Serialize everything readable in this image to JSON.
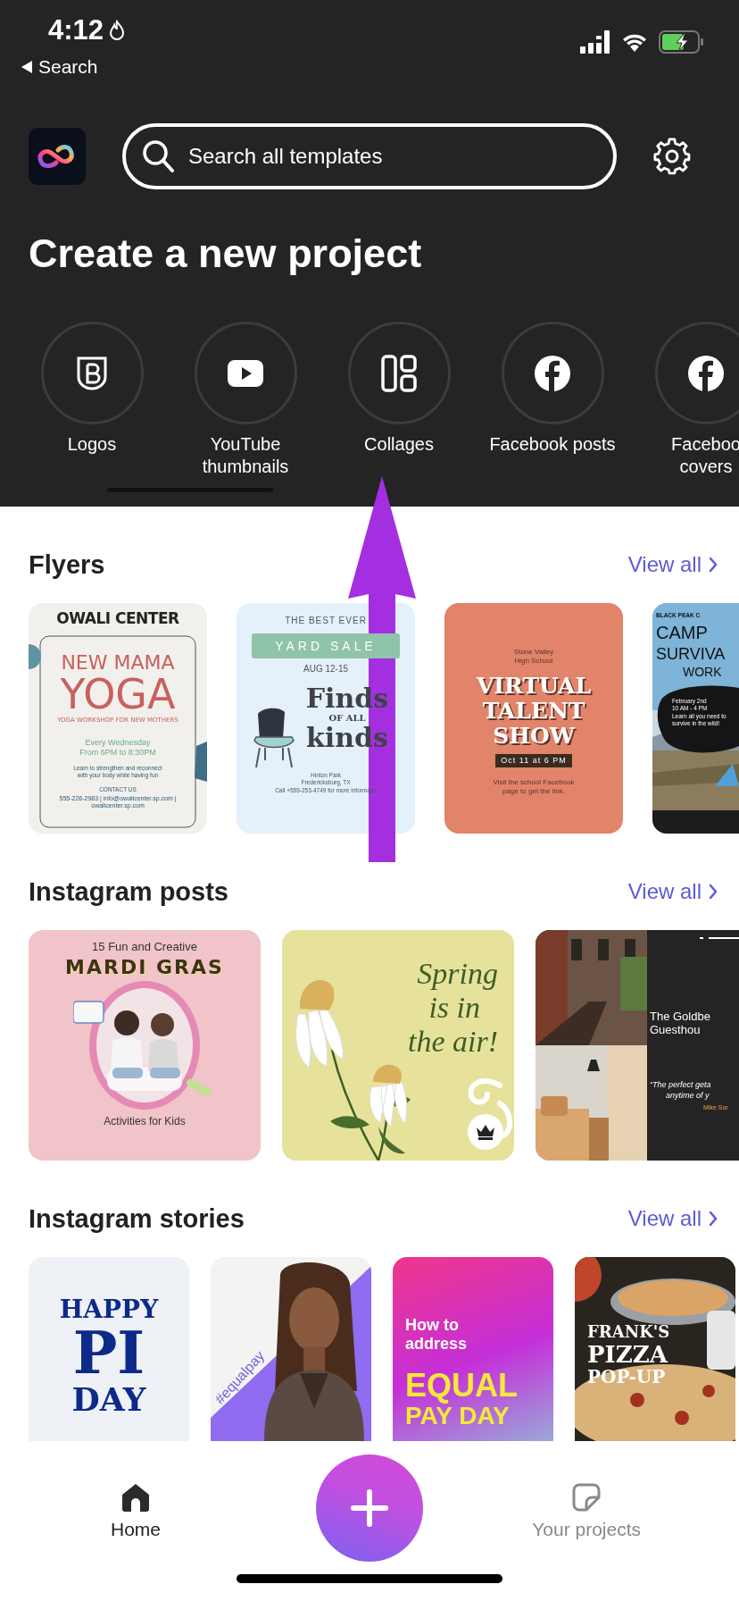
{
  "status_bar": {
    "time": "4:12",
    "back_label": "Search"
  },
  "header": {
    "search": {
      "placeholder": "Search all templates"
    }
  },
  "title": "Create a new project",
  "categories": [
    {
      "label": "Logos",
      "kind": "logo"
    },
    {
      "label": "YouTube thumbnails",
      "kind": "youtube"
    },
    {
      "label": "Collages",
      "kind": "collage"
    },
    {
      "label": "Facebook posts",
      "kind": "facebook"
    },
    {
      "label": "Faceboo covers",
      "kind": "facebook"
    }
  ],
  "sections": [
    {
      "title": "Flyers",
      "view_all": "View all",
      "templates": [
        {
          "kind": "yoga",
          "premium": false,
          "texts": [
            "OWALI CENTER",
            "NEW MAMA",
            "YOGA",
            "YOGA WORKSHOP FOR NEW MOTHERS",
            "Every Wednesday",
            "From 6PM to 8:30PM",
            "Learn to strengthen and reconnect",
            "with your body while having fun",
            "CONTACT US",
            "555-226-2983 | info@owalicenter.sp.com | owalicenter.sp.com"
          ]
        },
        {
          "kind": "yardsale",
          "premium": false,
          "texts": [
            "THE BEST EVER",
            "YARD SALE",
            "AUG 12-15",
            "Finds",
            "OF ALL",
            "kinds",
            "Hinton Park",
            "Fredericksburg, TX",
            "Call +555-253-4749 for more informatio"
          ]
        },
        {
          "kind": "talent",
          "premium": false,
          "texts": [
            "Stone Valley",
            "High School",
            "VIRTUAL",
            "TALENT",
            "SHOW",
            "Oct 11 at 6 PM",
            "Visit the school Facebook",
            "page to get the link."
          ]
        },
        {
          "kind": "camp",
          "premium": false,
          "texts": [
            "BLACK PEAK C",
            "CAMP",
            "SURVIVA",
            "WORK",
            "February 2nd",
            "10 AM - 4 PM",
            "Learn all you need to",
            "survive in the wild!"
          ]
        }
      ]
    },
    {
      "title": "Instagram posts",
      "view_all": "View all",
      "templates": [
        {
          "kind": "mardigras",
          "premium": false,
          "texts": [
            "15 Fun and Creative",
            "MARDI GRAS",
            "Activities for Kids"
          ]
        },
        {
          "kind": "spring",
          "premium": true,
          "texts": [
            "Spring",
            "is in",
            "the air!"
          ]
        },
        {
          "kind": "guesthouse",
          "premium": false,
          "texts": [
            "The Goldbe",
            "Guesthou",
            "“The perfect geta",
            "anytime of y",
            "Mike Sor"
          ]
        }
      ]
    },
    {
      "title": "Instagram stories",
      "view_all": "View all",
      "templates": [
        {
          "kind": "piday",
          "premium": false,
          "texts": [
            "HAPPY",
            "PI",
            "DAY"
          ]
        },
        {
          "kind": "equalpay",
          "premium": false,
          "texts": [
            "#equalpay"
          ]
        },
        {
          "kind": "equalday",
          "premium": false,
          "texts": [
            "How to",
            "address",
            "EQUAL",
            "PAY DAY"
          ]
        },
        {
          "kind": "pizza",
          "premium": false,
          "texts": [
            "FRANK'S",
            "PIZZA",
            "POP-UP"
          ]
        }
      ]
    }
  ],
  "bottom_nav": [
    {
      "label": "Home",
      "kind": "home",
      "selected": true
    },
    {
      "label": "Your projects",
      "kind": "projects",
      "selected": false
    }
  ]
}
